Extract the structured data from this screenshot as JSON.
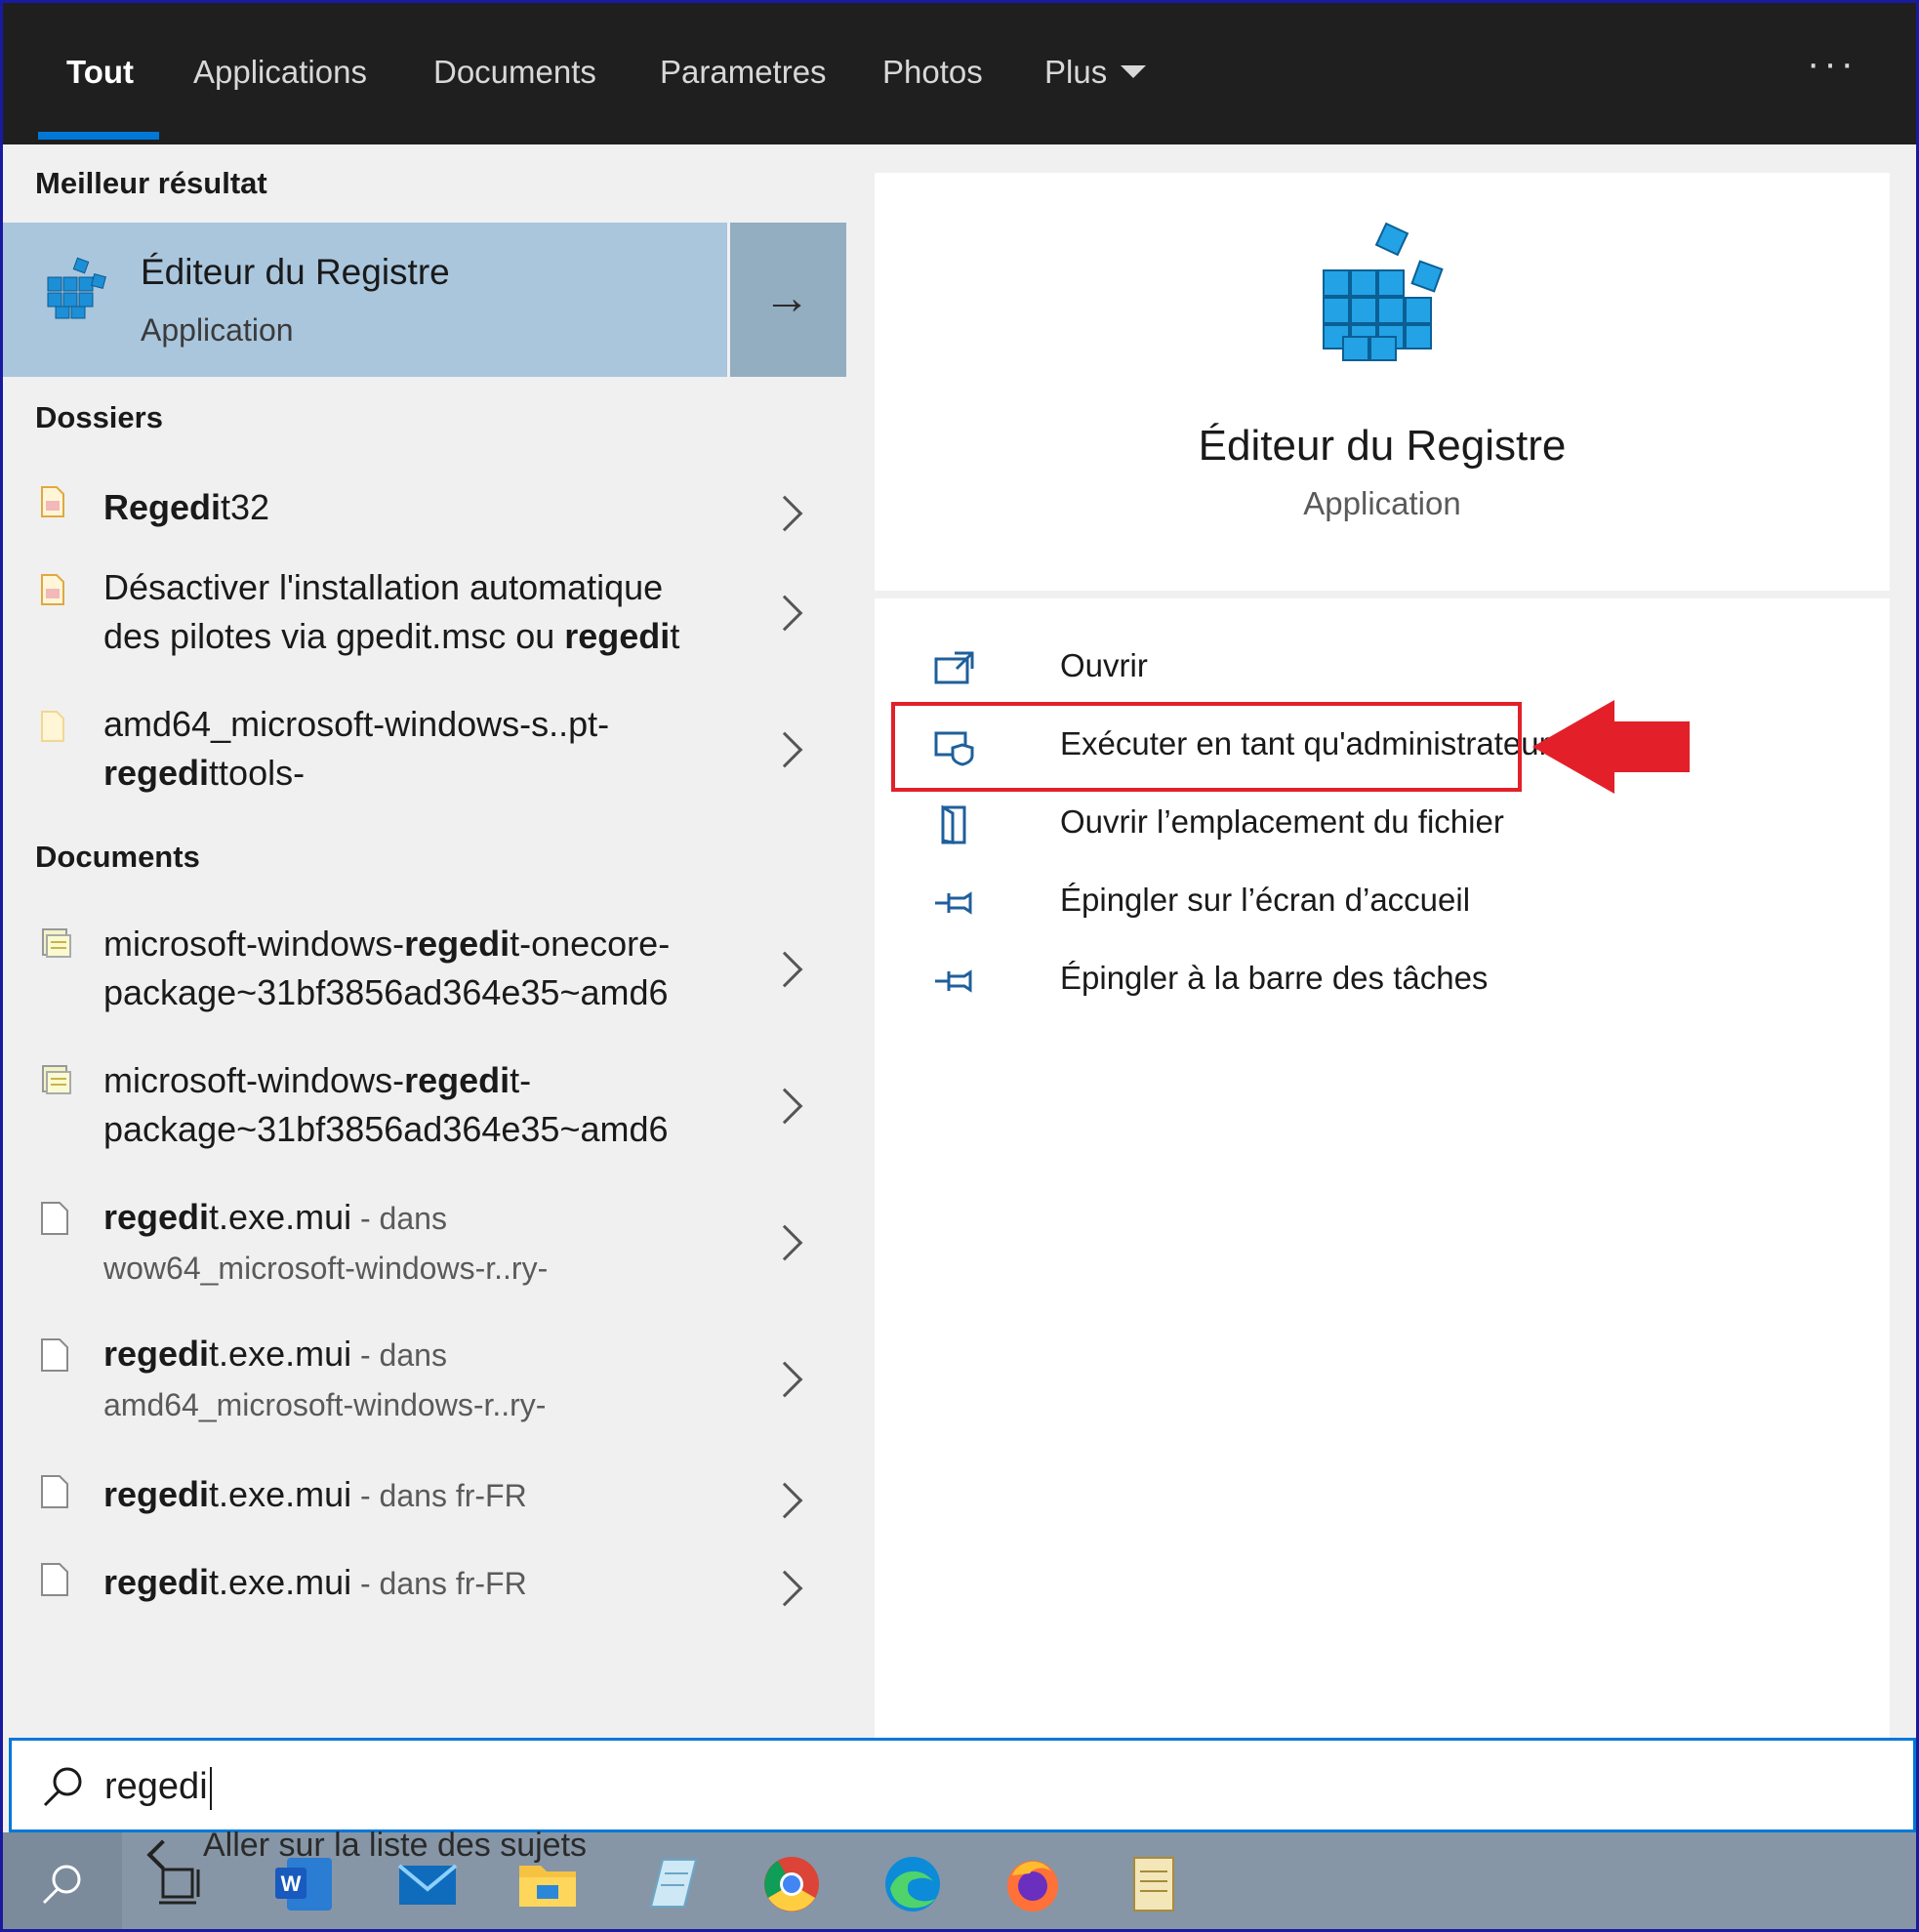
{
  "tabs": [
    {
      "label": "Tout",
      "active": true
    },
    {
      "label": "Applications"
    },
    {
      "label": "Documents"
    },
    {
      "label": "Parametres"
    },
    {
      "label": "Photos"
    },
    {
      "label": "Plus"
    }
  ],
  "more_icon": "ellipsis-icon",
  "left": {
    "best_title": "Meilleur résultat",
    "best": {
      "name": "Éditeur du Registre",
      "type": "Application"
    },
    "folders_title": "Dossiers",
    "folders": [
      {
        "bold": "Regedi",
        "rest": "t32"
      },
      {
        "line1": "Désactiver l'installation automatique",
        "line2_pre": "des pilotes via gpedit.msc ou ",
        "line2_bold": "regedi",
        "line2_post": "t"
      },
      {
        "line1": "amd64_microsoft-windows-s..pt-",
        "line2_bold": "regedi",
        "line2_post": "ttools-"
      }
    ],
    "documents_title": "Documents",
    "documents": [
      {
        "line1_pre": "microsoft-windows-",
        "line1_bold": "regedi",
        "line1_post": "t-onecore-",
        "line2": "package~31bf3856ad364e35~amd6"
      },
      {
        "line1_pre": "microsoft-windows-",
        "line1_bold": "regedi",
        "line1_post": "t-",
        "line2": "package~31bf3856ad364e35~amd6"
      },
      {
        "bold": "regedi",
        "rest": "t.exe.mui",
        "loc": " - dans",
        "line2": "wow64_microsoft-windows-r..ry-"
      },
      {
        "bold": "regedi",
        "rest": "t.exe.mui",
        "loc": " - dans",
        "line2": "amd64_microsoft-windows-r..ry-"
      },
      {
        "bold": "regedi",
        "rest": "t.exe.mui",
        "loc": " - dans fr-FR"
      },
      {
        "bold": "regedi",
        "rest": "t.exe.mui",
        "loc": " - dans fr-FR"
      }
    ]
  },
  "preview": {
    "title": "Éditeur du Registre",
    "subtitle": "Application",
    "actions": [
      {
        "label": "Ouvrir",
        "icon": "open-icon"
      },
      {
        "label": "Exécuter en tant qu'administrateur",
        "icon": "shield-icon"
      },
      {
        "label": "Ouvrir l’emplacement du fichier",
        "icon": "file-location-icon"
      },
      {
        "label": "Épingler sur l’écran d’accueil",
        "icon": "pin-icon"
      },
      {
        "label": "Épingler à la barre des tâches",
        "icon": "pin-icon"
      }
    ]
  },
  "search": {
    "value": "regedi",
    "icon": "search-icon"
  },
  "tooltip": "Aller sur la liste des sujets",
  "taskbar": [
    "search-icon",
    "task-view-icon",
    "word-icon",
    "mail-icon",
    "file-explorer-icon",
    "notepad-icon",
    "chrome-icon",
    "edge-icon",
    "firefox-icon",
    "script-icon"
  ],
  "colors": {
    "accent": "#0078d7",
    "highlight": "#e3202a",
    "selected_bg": "#a9c6dd"
  }
}
